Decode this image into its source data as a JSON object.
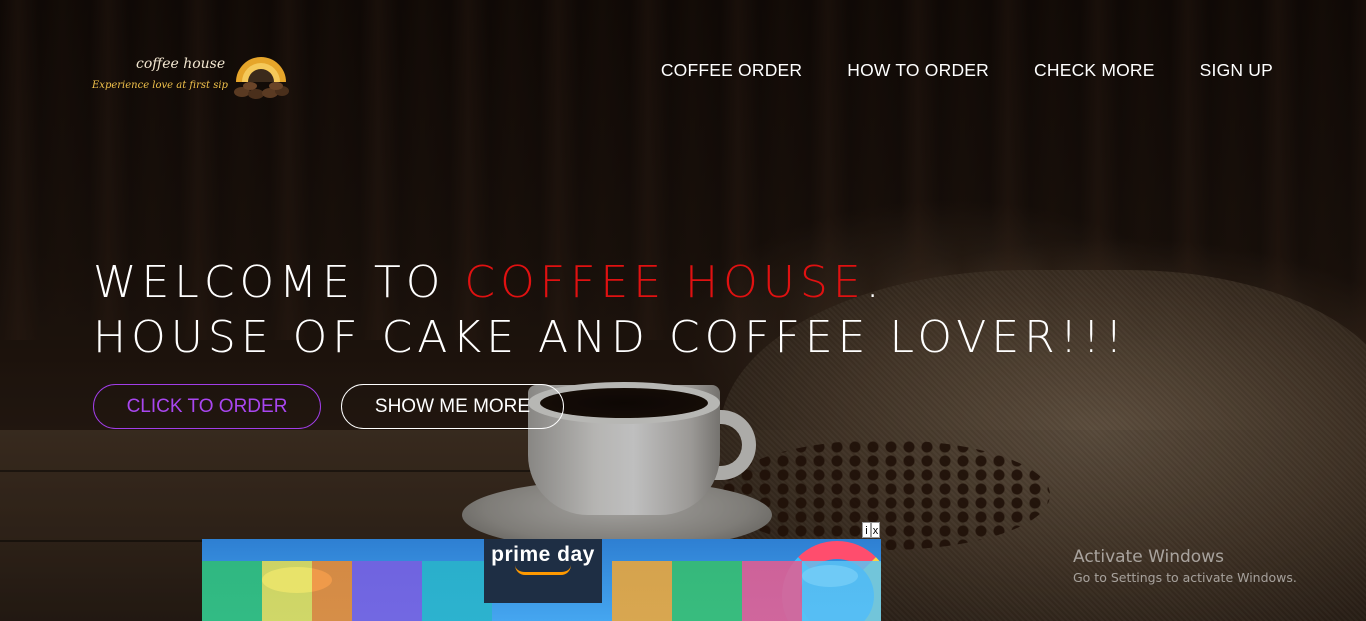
{
  "header": {
    "logo": {
      "name": "coffee house",
      "tagline": "Experience love at first sip",
      "icon": "coffee-beans-sunrise-icon"
    },
    "nav": [
      {
        "label": "COFFEE ORDER"
      },
      {
        "label": "HOW TO ORDER"
      },
      {
        "label": "CHECK MORE"
      },
      {
        "label": "SIGN UP"
      }
    ]
  },
  "hero": {
    "line1_prefix": "WELCOME TO ",
    "line1_highlight": "COFFEE HOUSE",
    "line1_suffix": ".",
    "line2": "HOUSE OF CAKE AND COFFEE LOVER!!!",
    "buttons": {
      "primary": "CLICK TO ORDER",
      "secondary": "SHOW ME MORE"
    }
  },
  "ad": {
    "text": "prime day",
    "info_glyph": "i",
    "close_glyph": "x"
  },
  "watermark": {
    "title": "Activate Windows",
    "subtitle": "Go to Settings to activate Windows."
  },
  "colors": {
    "accent_red": "#e01111",
    "primary_button": "#a946f0",
    "logo_tagline": "#f0c14b"
  }
}
